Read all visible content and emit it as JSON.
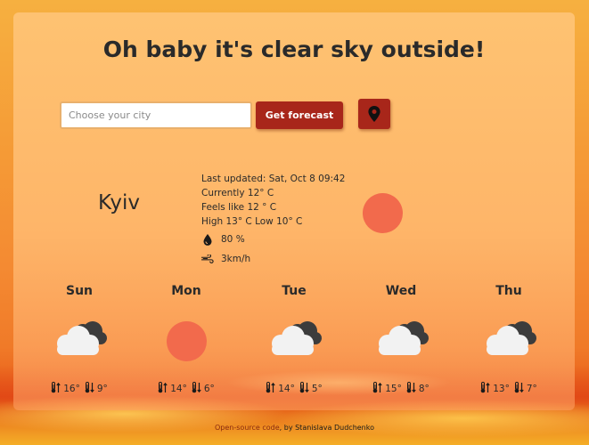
{
  "header": {
    "title": "Oh baby it's clear sky outside!"
  },
  "search": {
    "placeholder": "Choose your city",
    "value": "",
    "submit_label": "Get forecast",
    "location_icon": "map-pin-icon"
  },
  "current": {
    "city": "Kyiv",
    "last_updated": "Last updated: Sat, Oct 8 09:42",
    "currently": "Currently 12° C",
    "feels_like": "Feels like 12 ° C",
    "high_low": "High 13° C Low 10° C",
    "humidity": "80 %",
    "wind": "3km/h",
    "condition_icon": "sun-icon",
    "icons": {
      "humidity": "droplet-icon",
      "wind": "wind-icon"
    }
  },
  "forecast": [
    {
      "day": "Sun",
      "icon": "cloud-icon",
      "max": "16°",
      "min": "9°"
    },
    {
      "day": "Mon",
      "icon": "sun-icon",
      "max": "14°",
      "min": "6°"
    },
    {
      "day": "Tue",
      "icon": "cloud-icon",
      "max": "14°",
      "min": "5°"
    },
    {
      "day": "Wed",
      "icon": "cloud-icon",
      "max": "15°",
      "min": "8°"
    },
    {
      "day": "Thu",
      "icon": "cloud-icon",
      "max": "13°",
      "min": "7°"
    }
  ],
  "footer": {
    "link_text": "Open-source code",
    "suffix": ", by Stanislava Dudchenko"
  },
  "colors": {
    "accent": "#a8261a",
    "sun": "#f26a4c"
  }
}
